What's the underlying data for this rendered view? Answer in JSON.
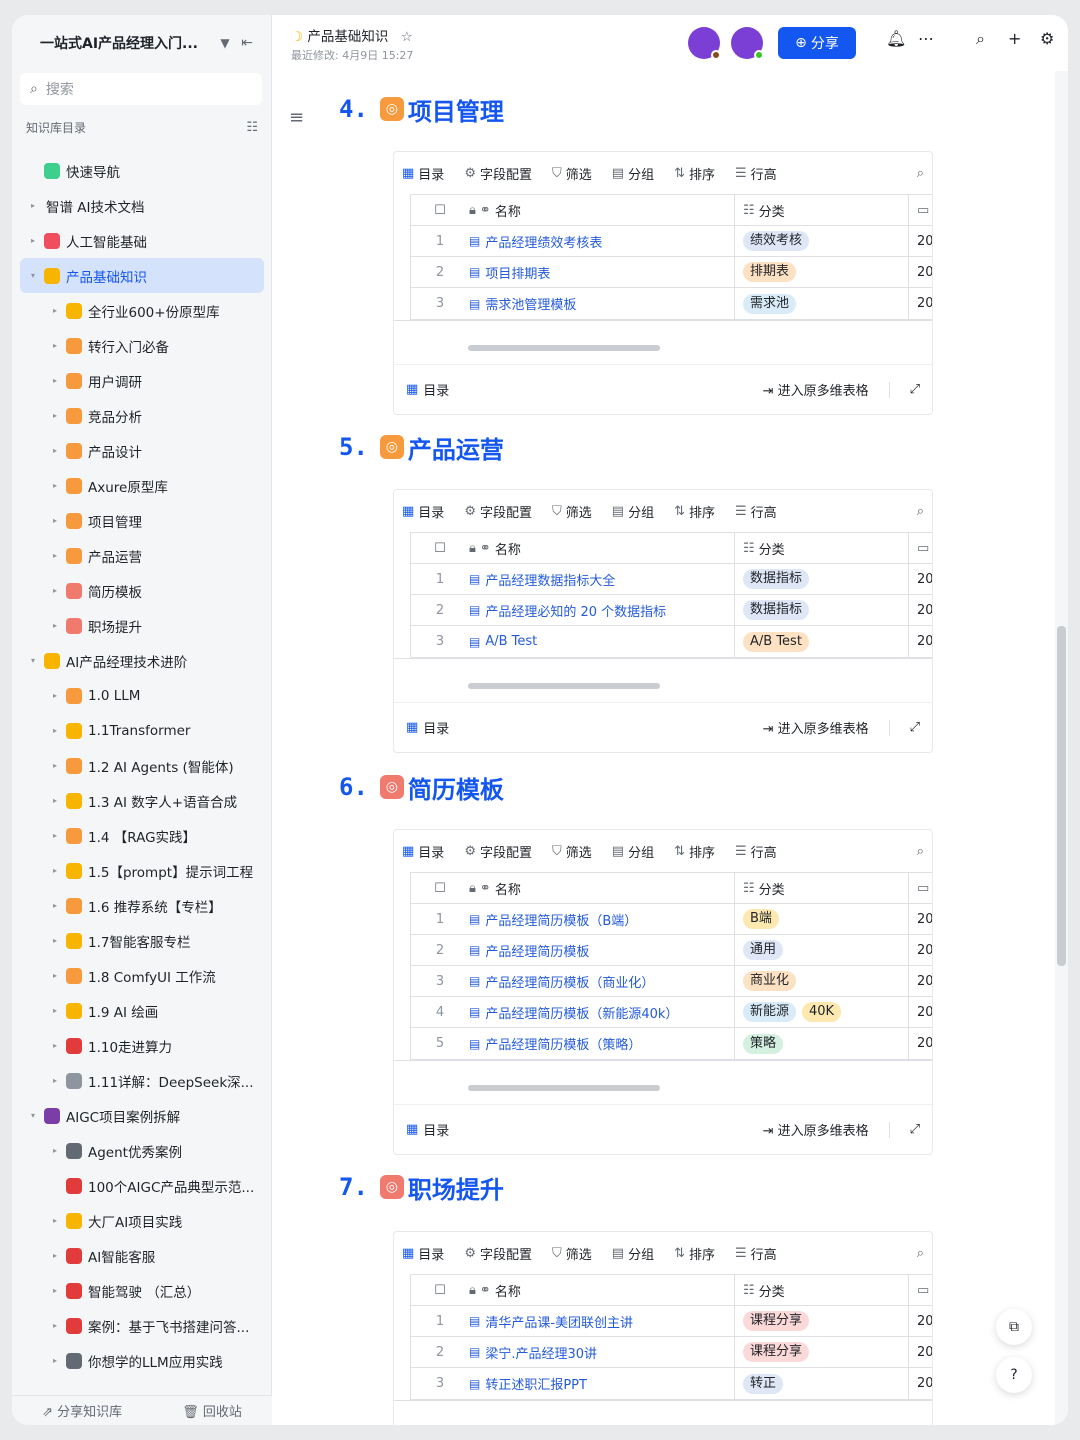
{
  "sidebar": {
    "title": "一站式AI产品经理入门...",
    "search_placeholder": "搜索",
    "toc_label": "知识库目录",
    "items": [
      {
        "label": "快速导航",
        "level": 0,
        "arrow": "",
        "icon": "compass-icon",
        "color": "#3ecf8e",
        "active": false
      },
      {
        "label": "智谱 AI技术文档",
        "level": 0,
        "arrow": "▸",
        "icon": "",
        "color": "",
        "active": false
      },
      {
        "label": "人工智能基础",
        "level": 0,
        "arrow": "▸",
        "icon": "heart-eyes-icon",
        "color": "#f04e5e",
        "active": false
      },
      {
        "label": "产品基础知识",
        "level": 0,
        "arrow": "▾",
        "icon": "moon-icon",
        "color": "#f7b500",
        "active": true
      },
      {
        "label": "全行业600+份原型库",
        "level": 1,
        "arrow": "▸",
        "icon": "muscle-icon",
        "color": "#f7b500",
        "active": false
      },
      {
        "label": "转行入门必备",
        "level": 1,
        "arrow": "▸",
        "icon": "doc-icon",
        "color": "#f79a3e",
        "active": false
      },
      {
        "label": "用户调研",
        "level": 1,
        "arrow": "▸",
        "icon": "doc-icon",
        "color": "#f79a3e",
        "active": false
      },
      {
        "label": "竞品分析",
        "level": 1,
        "arrow": "▸",
        "icon": "doc-icon",
        "color": "#f79a3e",
        "active": false
      },
      {
        "label": "产品设计",
        "level": 1,
        "arrow": "▸",
        "icon": "doc-icon",
        "color": "#f79a3e",
        "active": false
      },
      {
        "label": "Axure原型库",
        "level": 1,
        "arrow": "▸",
        "icon": "doc-icon",
        "color": "#f79a3e",
        "active": false
      },
      {
        "label": "项目管理",
        "level": 1,
        "arrow": "▸",
        "icon": "doc-icon",
        "color": "#f79a3e",
        "active": false
      },
      {
        "label": "产品运营",
        "level": 1,
        "arrow": "▸",
        "icon": "doc-icon",
        "color": "#f79a3e",
        "active": false
      },
      {
        "label": "简历模板",
        "level": 1,
        "arrow": "▸",
        "icon": "doc-icon",
        "color": "#f07a6e",
        "active": false
      },
      {
        "label": "职场提升",
        "level": 1,
        "arrow": "▸",
        "icon": "doc-icon",
        "color": "#f07a6e",
        "active": false
      },
      {
        "label": "AI产品经理技术进阶",
        "level": 0,
        "arrow": "▾",
        "icon": "muscle-icon",
        "color": "#f7b500",
        "active": false
      },
      {
        "label": "1.0 LLM",
        "level": 1,
        "arrow": "▸",
        "icon": "doc-icon",
        "color": "#f79a3e",
        "active": false
      },
      {
        "label": "1.1Transformer",
        "level": 1,
        "arrow": "▸",
        "icon": "doc-icon",
        "color": "#f7b500",
        "active": false
      },
      {
        "label": "1.2 AI Agents (智能体)",
        "level": 1,
        "arrow": "▸",
        "icon": "doc-icon",
        "color": "#f79a3e",
        "active": false
      },
      {
        "label": "1.3 AI 数字人+语音合成",
        "level": 1,
        "arrow": "▸",
        "icon": "doc-icon",
        "color": "#f7b500",
        "active": false
      },
      {
        "label": "1.4 【RAG实践】",
        "level": 1,
        "arrow": "▸",
        "icon": "doc-icon",
        "color": "#f79a3e",
        "active": false
      },
      {
        "label": "1.5【prompt】提示词工程",
        "level": 1,
        "arrow": "▸",
        "icon": "doc-icon",
        "color": "#f7b500",
        "active": false
      },
      {
        "label": "1.6 推荐系统【专栏】",
        "level": 1,
        "arrow": "▸",
        "icon": "doc-icon",
        "color": "#f79a3e",
        "active": false
      },
      {
        "label": "1.7智能客服专栏",
        "level": 1,
        "arrow": "▸",
        "icon": "doc-icon",
        "color": "#f7b500",
        "active": false
      },
      {
        "label": "1.8 ComfyUI 工作流",
        "level": 1,
        "arrow": "▸",
        "icon": "doc-icon",
        "color": "#f79a3e",
        "active": false
      },
      {
        "label": "1.9 AI 绘画",
        "level": 1,
        "arrow": "▸",
        "icon": "doc-icon",
        "color": "#f7b500",
        "active": false
      },
      {
        "label": "1.10走进算力",
        "level": 1,
        "arrow": "▸",
        "icon": "rocket-icon",
        "color": "#e23b3b",
        "active": false
      },
      {
        "label": "1.11详解：DeepSeek深...",
        "level": 1,
        "arrow": "▸",
        "icon": "gear-icon",
        "color": "#8f959e",
        "active": false
      },
      {
        "label": "AIGC项目案例拆解",
        "level": 0,
        "arrow": "▾",
        "icon": "floppy-icon",
        "color": "#7a3ea6",
        "active": false
      },
      {
        "label": "Agent优秀案例",
        "level": 1,
        "arrow": "▸",
        "icon": "robot-icon",
        "color": "#646a73",
        "active": false
      },
      {
        "label": "100个AIGC产品典型示范...",
        "level": 1,
        "arrow": "",
        "icon": "hundred-icon",
        "color": "#e23b3b",
        "active": false
      },
      {
        "label": "大厂AI项目实践",
        "level": 1,
        "arrow": "▸",
        "icon": "medal-icon",
        "color": "#f7b500",
        "active": false
      },
      {
        "label": "AI智能客服",
        "level": 1,
        "arrow": "▸",
        "icon": "phone-icon",
        "color": "#e23b3b",
        "active": false
      },
      {
        "label": "智能驾驶 （汇总）",
        "level": 1,
        "arrow": "▸",
        "icon": "car-icon",
        "color": "#e23b3b",
        "active": false
      },
      {
        "label": "案例：基于飞书搭建问答...",
        "level": 1,
        "arrow": "▸",
        "icon": "pin-icon",
        "color": "#e23b3b",
        "active": false
      },
      {
        "label": "你想学的LLM应用实践",
        "level": 1,
        "arrow": "▸",
        "icon": "tools-icon",
        "color": "#646a73",
        "active": false
      }
    ],
    "footer_share": "分享知识库",
    "footer_trash": "回收站"
  },
  "topbar": {
    "title": "产品基础知识",
    "last_modified": "最近修改: 4月9日 15:27",
    "share_label": "分享"
  },
  "toolbar_labels": {
    "toc": "目录",
    "fields": "字段配置",
    "filter": "筛选",
    "group": "分组",
    "sort": "排序",
    "row_height": "行高"
  },
  "grid_header": {
    "name": "名称",
    "category": "分类"
  },
  "block_footer": {
    "toc": "目录",
    "open_base": "进入原多维表格"
  },
  "sections": [
    {
      "num": "4.",
      "title": "项目管理",
      "icon_color": "#f79a3e",
      "rows": [
        {
          "idx": "1",
          "name": "产品经理绩效考核表",
          "tags": [
            {
              "t": "绩效考核",
              "c": "#dfe6f5"
            }
          ],
          "date": "20"
        },
        {
          "idx": "2",
          "name": "项目排期表",
          "tags": [
            {
              "t": "排期表",
              "c": "#fde1c3"
            }
          ],
          "date": "20"
        },
        {
          "idx": "3",
          "name": "需求池管理模板",
          "tags": [
            {
              "t": "需求池",
              "c": "#d8ebf7"
            }
          ],
          "date": "20"
        }
      ]
    },
    {
      "num": "5.",
      "title": "产品运营",
      "icon_color": "#f79a3e",
      "rows": [
        {
          "idx": "1",
          "name": "产品经理数据指标大全",
          "tags": [
            {
              "t": "数据指标",
              "c": "#dfe6f5"
            }
          ],
          "date": "20"
        },
        {
          "idx": "2",
          "name": "产品经理必知的 20 个数据指标",
          "tags": [
            {
              "t": "数据指标",
              "c": "#dfe6f5"
            }
          ],
          "date": "20"
        },
        {
          "idx": "3",
          "name": "A/B Test",
          "tags": [
            {
              "t": "A/B Test",
              "c": "#fde1c3"
            }
          ],
          "date": "20"
        }
      ]
    },
    {
      "num": "6.",
      "title": "简历模板",
      "icon_color": "#f07a6e",
      "rows": [
        {
          "idx": "1",
          "name": "产品经理简历模板（B端）",
          "tags": [
            {
              "t": "B端",
              "c": "#fde8b0"
            }
          ],
          "date": "202"
        },
        {
          "idx": "2",
          "name": "产品经理简历模板",
          "tags": [
            {
              "t": "通用",
              "c": "#dfe6f5"
            }
          ],
          "date": "202"
        },
        {
          "idx": "3",
          "name": "产品经理简历模板（商业化）",
          "tags": [
            {
              "t": "商业化",
              "c": "#fde1c3"
            }
          ],
          "date": "202"
        },
        {
          "idx": "4",
          "name": "产品经理简历模板（新能源40k）",
          "tags": [
            {
              "t": "新能源",
              "c": "#d8ebf7"
            },
            {
              "t": "40K",
              "c": "#fde8b0"
            }
          ],
          "date": "202"
        },
        {
          "idx": "5",
          "name": "产品经理简历模板（策略）",
          "tags": [
            {
              "t": "策略",
              "c": "#d4f0e0"
            }
          ],
          "date": "202"
        }
      ]
    },
    {
      "num": "7.",
      "title": "职场提升",
      "icon_color": "#f07a6e",
      "rows": [
        {
          "idx": "1",
          "name": "清华产品课-美团联创主讲",
          "tags": [
            {
              "t": "课程分享",
              "c": "#fbd9d9"
            }
          ],
          "date": "20"
        },
        {
          "idx": "2",
          "name": "梁宁.产品经理30讲",
          "tags": [
            {
              "t": "课程分享",
              "c": "#fbd9d9"
            }
          ],
          "date": "20"
        },
        {
          "idx": "3",
          "name": "转正述职汇报PPT",
          "tags": [
            {
              "t": "转正",
              "c": "#dfe6f5"
            }
          ],
          "date": "20"
        }
      ]
    }
  ],
  "colors": {
    "accent": "#1456f0",
    "link": "#245bdb"
  }
}
